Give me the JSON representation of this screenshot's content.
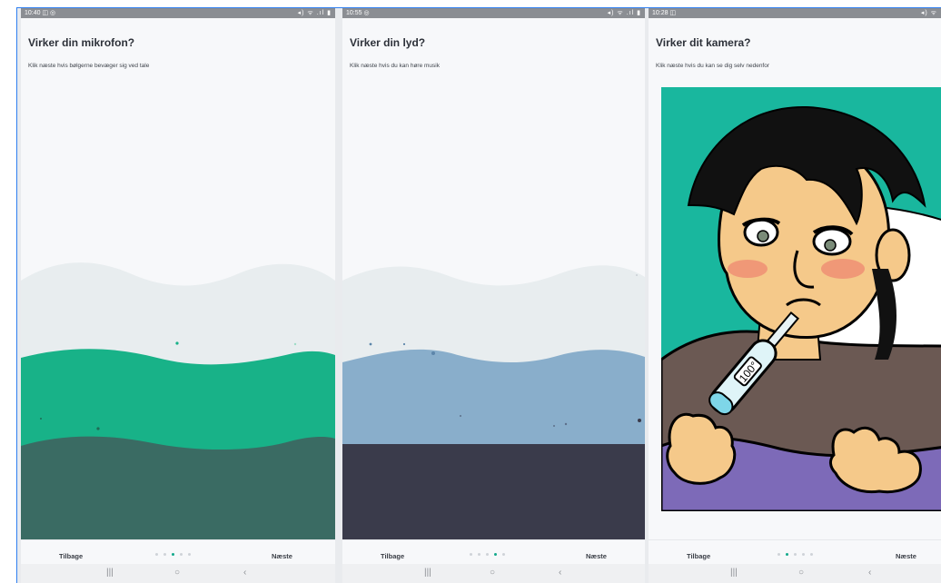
{
  "panels": [
    {
      "status_time": "10:40",
      "status_icons": "◫ ◎",
      "status_right": "◂) ᯤ .ıl ▮",
      "title": "Virker din mikrofon?",
      "subtitle": "Klik næste hvis bølgerne bevæger sig ved tale",
      "back_label": "Tilbage",
      "next_label": "Næste",
      "step": 3,
      "steps_total": 5,
      "colors": {
        "bg": "#f7f8fa",
        "light_wave": "#e8edef",
        "mid_wave": "#18b288",
        "dark_wave": "#3a6b63"
      }
    },
    {
      "status_time": "10:55",
      "status_icons": "◎",
      "status_right": "◂) ᯤ .ıl ▮",
      "title": "Virker din lyd?",
      "subtitle": "Klik næste hvis du kan høre musik",
      "back_label": "Tilbage",
      "next_label": "Næste",
      "step": 4,
      "steps_total": 5,
      "colors": {
        "bg": "#f7f8fa",
        "light_wave": "#e8edef",
        "mid_wave": "#89aecb",
        "dark_wave": "#3a3b4b"
      }
    },
    {
      "status_time": "10:28",
      "status_icons": "◫",
      "status_right": "◂) ᯤ",
      "title": "Virker dit kamera?",
      "subtitle": "Klik næste hvis du kan se dig selv nedenfor",
      "back_label": "Tilbage",
      "next_label": "Næste",
      "step": 2,
      "steps_total": 5,
      "colors": {
        "bg": "#f7f8fa",
        "photo_bg": "#19b79e",
        "blanket": "#7d6ab8",
        "shirt": "#6b5953"
      }
    }
  ],
  "nav": {
    "recents": "|||",
    "home": "○",
    "back": "‹"
  }
}
